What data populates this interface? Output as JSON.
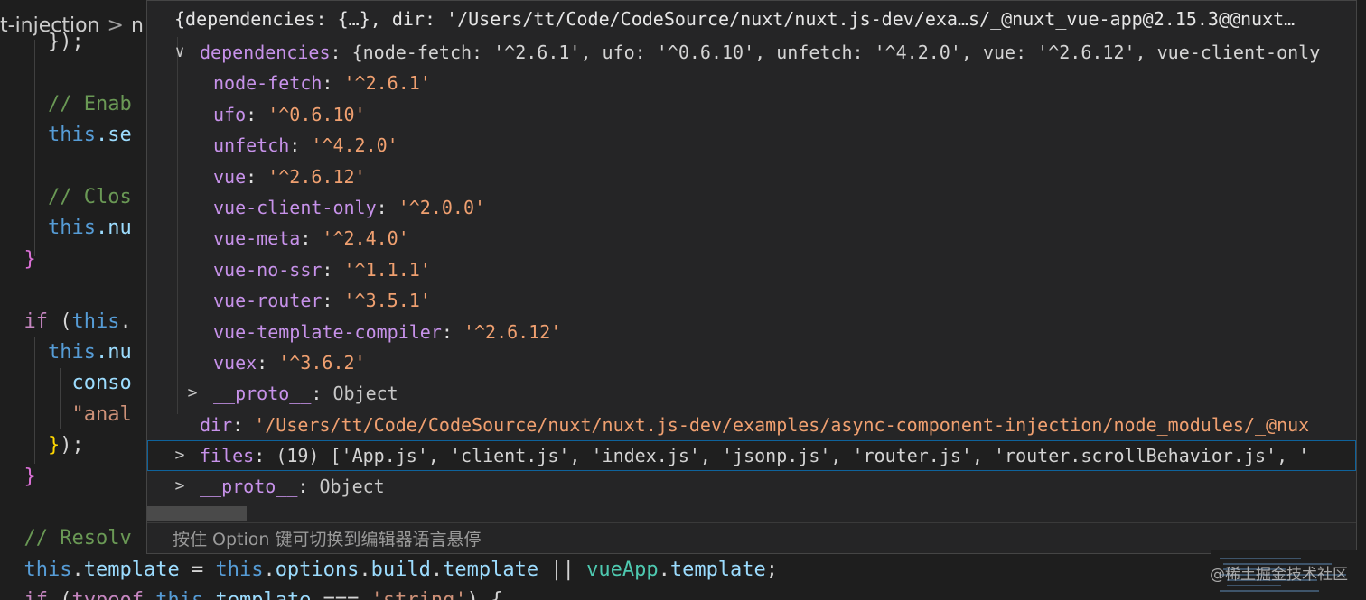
{
  "breadcrumb": {
    "segment_1": "t-injection",
    "separator": ">",
    "segment_2": "n"
  },
  "editor": {
    "lines": [
      {
        "parts": [
          {
            "t": "    });",
            "c": "punct"
          }
        ]
      },
      {
        "parts": [
          {
            "t": "",
            "c": "punct"
          }
        ]
      },
      {
        "parts": [
          {
            "t": "    // Enab",
            "c": "comment"
          }
        ]
      },
      {
        "parts": [
          {
            "t": "    ",
            "c": "punct"
          },
          {
            "t": "this",
            "c": "this"
          },
          {
            "t": ".se",
            "c": "prop"
          }
        ]
      },
      {
        "parts": [
          {
            "t": "",
            "c": "punct"
          }
        ]
      },
      {
        "parts": [
          {
            "t": "    // Clos",
            "c": "comment"
          }
        ]
      },
      {
        "parts": [
          {
            "t": "    ",
            "c": "punct"
          },
          {
            "t": "this",
            "c": "this"
          },
          {
            "t": ".nu",
            "c": "prop"
          }
        ]
      },
      {
        "parts": [
          {
            "t": "  }",
            "c": "brace"
          }
        ]
      },
      {
        "parts": [
          {
            "t": "",
            "c": "punct"
          }
        ]
      },
      {
        "parts": [
          {
            "t": "  ",
            "c": "punct"
          },
          {
            "t": "if",
            "c": "keyword"
          },
          {
            "t": " (",
            "c": "punct"
          },
          {
            "t": "this",
            "c": "this"
          },
          {
            "t": ".",
            "c": "punct"
          }
        ]
      },
      {
        "parts": [
          {
            "t": "    ",
            "c": "punct"
          },
          {
            "t": "this",
            "c": "this"
          },
          {
            "t": ".nu",
            "c": "prop"
          }
        ]
      },
      {
        "parts": [
          {
            "t": "      ",
            "c": "punct"
          },
          {
            "t": "conso",
            "c": "prop"
          }
        ]
      },
      {
        "parts": [
          {
            "t": "      ",
            "c": "punct"
          },
          {
            "t": "\"anal",
            "c": "string"
          }
        ]
      },
      {
        "parts": [
          {
            "t": "    ",
            "c": "punct"
          },
          {
            "t": "}",
            "c": "brace2"
          },
          {
            "t": ");",
            "c": "punct"
          }
        ]
      },
      {
        "parts": [
          {
            "t": "  }",
            "c": "brace"
          }
        ]
      },
      {
        "parts": [
          {
            "t": "",
            "c": "punct"
          }
        ]
      },
      {
        "parts": [
          {
            "t": "  // Resolv",
            "c": "comment"
          }
        ]
      },
      {
        "parts": [
          {
            "t": "  ",
            "c": "punct"
          },
          {
            "t": "this",
            "c": "this"
          },
          {
            "t": ".",
            "c": "punct"
          },
          {
            "t": "template",
            "c": "prop"
          },
          {
            "t": " = ",
            "c": "punct"
          },
          {
            "t": "this",
            "c": "this"
          },
          {
            "t": ".",
            "c": "punct"
          },
          {
            "t": "options",
            "c": "prop"
          },
          {
            "t": ".",
            "c": "punct"
          },
          {
            "t": "build",
            "c": "prop"
          },
          {
            "t": ".",
            "c": "punct"
          },
          {
            "t": "template",
            "c": "prop"
          },
          {
            "t": " || ",
            "c": "punct"
          },
          {
            "t": "vueApp",
            "c": "class"
          },
          {
            "t": ".",
            "c": "punct"
          },
          {
            "t": "template",
            "c": "prop"
          },
          {
            "t": ";",
            "c": "punct"
          }
        ]
      },
      {
        "parts": [
          {
            "t": "  ",
            "c": "punct"
          },
          {
            "t": "if",
            "c": "keyword"
          },
          {
            "t": " (",
            "c": "punct"
          },
          {
            "t": "typeof",
            "c": "keyword"
          },
          {
            "t": " ",
            "c": "punct"
          },
          {
            "t": "this",
            "c": "this"
          },
          {
            "t": ".",
            "c": "punct"
          },
          {
            "t": "template",
            "c": "prop"
          },
          {
            "t": " === ",
            "c": "punct"
          },
          {
            "t": "'string'",
            "c": "string"
          },
          {
            "t": ") {",
            "c": "punct"
          }
        ]
      }
    ]
  },
  "hover": {
    "header": "{dependencies: {…}, dir: '/Users/tt/Code/CodeSource/nuxt/nuxt.js-dev/exa…s/_@nuxt_vue-app@2.15.3@@nuxt…",
    "dependencies_row": {
      "chevron": "∨",
      "key": "dependencies",
      "preview": "{node-fetch: '^2.6.1', ufo: '^0.6.10', unfetch: '^4.2.0', vue: '^2.6.12', vue-client-only"
    },
    "deps": [
      {
        "key": "node-fetch",
        "value": "'^2.6.1'"
      },
      {
        "key": "ufo",
        "value": "'^0.6.10'"
      },
      {
        "key": "unfetch",
        "value": "'^4.2.0'"
      },
      {
        "key": "vue",
        "value": "'^2.6.12'"
      },
      {
        "key": "vue-client-only",
        "value": "'^2.0.0'"
      },
      {
        "key": "vue-meta",
        "value": "'^2.4.0'"
      },
      {
        "key": "vue-no-ssr",
        "value": "'^1.1.1'"
      },
      {
        "key": "vue-router",
        "value": "'^3.5.1'"
      },
      {
        "key": "vue-template-compiler",
        "value": "'^2.6.12'"
      },
      {
        "key": "vuex",
        "value": "'^3.6.2'"
      }
    ],
    "deps_proto": {
      "chevron": ">",
      "key": "__proto__",
      "value": "Object"
    },
    "dir_row": {
      "key": "dir",
      "value": "'/Users/tt/Code/CodeSource/nuxt/nuxt.js-dev/examples/async-component-injection/node_modules/_@nux"
    },
    "files_row": {
      "chevron": ">",
      "key": "files",
      "value": "(19) ['App.js', 'client.js', 'index.js', 'jsonp.js', 'router.js', 'router.scrollBehavior.js', '"
    },
    "root_proto": {
      "chevron": ">",
      "key": "__proto__",
      "value": "Object"
    },
    "footer_hint": "按住 Option 键可切换到编辑器语言悬停"
  },
  "watermark": "@稀土掘金技术社区",
  "colors": {
    "background": "#1e1e1e",
    "hover_background": "#252526",
    "selection_border": "#0e639c",
    "key_purple": "#c792ea",
    "string_orange": "#f0a070"
  }
}
